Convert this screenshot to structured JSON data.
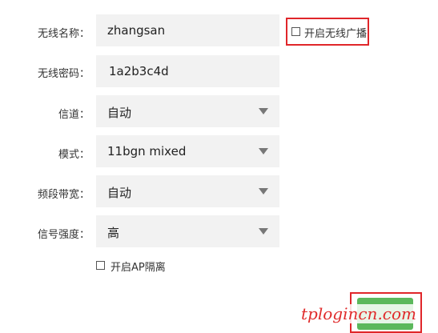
{
  "form": {
    "ssid": {
      "label": "无线名称：",
      "value": "zhangsan"
    },
    "broadcast": {
      "label": "开启无线广播",
      "checked": false
    },
    "password": {
      "label": "无线密码：",
      "value": "1a2b3c4d"
    },
    "channel": {
      "label": "信道：",
      "value": "自动"
    },
    "mode": {
      "label": "模式：",
      "value": "11bgn mixed"
    },
    "bandwidth": {
      "label": "频段带宽：",
      "value": "自动"
    },
    "signal_strength": {
      "label": "信号强度：",
      "value": "高"
    },
    "ap_isolation": {
      "label": "开启AP隔离",
      "checked": false
    }
  },
  "watermark": "tplogincn.com",
  "colors": {
    "highlight": "#e0262a",
    "field_bg": "#f2f2f2",
    "save_button": "#5cb85c"
  }
}
